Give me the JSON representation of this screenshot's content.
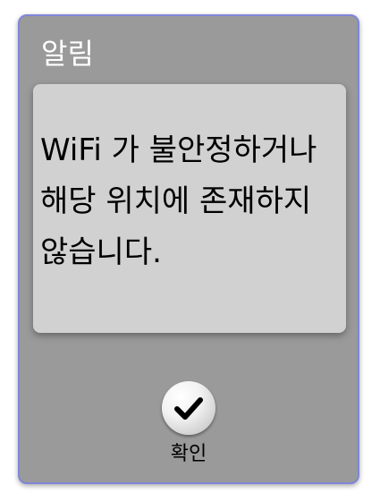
{
  "dialog": {
    "title": "알림",
    "message": "WiFi 가 불안정하거나 해당 위치에 존재하지 않습니다.",
    "confirm_button": {
      "label": "확인",
      "icon": "checkmark-icon"
    }
  },
  "colors": {
    "dialog_background": "#9a9a9a",
    "dialog_border": "#7f86d8",
    "message_background": "#d1d1d1",
    "title_text": "#ffffff",
    "message_text": "#000000"
  }
}
